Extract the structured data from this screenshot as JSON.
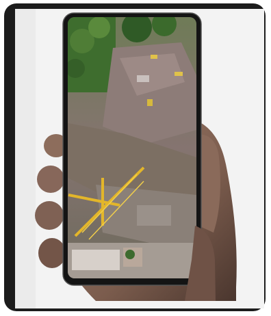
{
  "image": {
    "subject": "hand-holding-smartphone-aerial-construction-site",
    "colors": {
      "frame": "#1c1c1c",
      "backdrop": "#f3f3f3",
      "skin": "#8a6a5a",
      "phone_body": "#141414",
      "crane": "#e3b62a",
      "rooftop": "#8d7c78",
      "trees": "#3e6d2e"
    }
  }
}
